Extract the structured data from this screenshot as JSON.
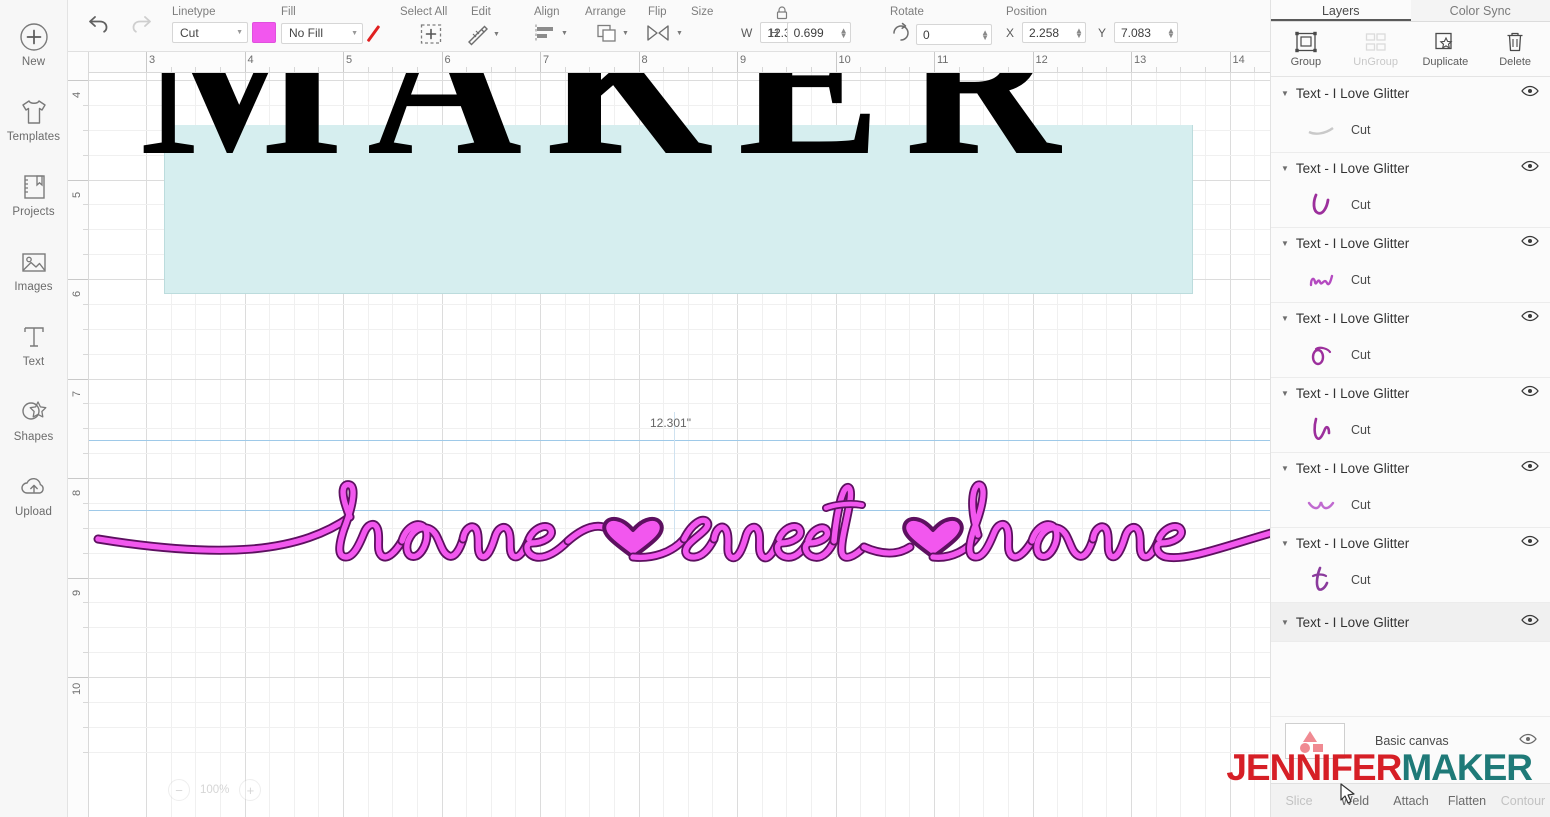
{
  "sidebar": {
    "items": [
      {
        "label": "New",
        "icon": "plus-circle-icon"
      },
      {
        "label": "Templates",
        "icon": "tshirt-icon"
      },
      {
        "label": "Projects",
        "icon": "notebook-icon"
      },
      {
        "label": "Images",
        "icon": "photo-icon"
      },
      {
        "label": "Text",
        "icon": "text-t-icon"
      },
      {
        "label": "Shapes",
        "icon": "shapes-icon"
      },
      {
        "label": "Upload",
        "icon": "upload-cloud-icon"
      }
    ]
  },
  "toolbar": {
    "undo": "undo-icon",
    "redo": "redo-icon",
    "linetype": {
      "label": "Linetype",
      "value": "Cut",
      "swatch_color": "#F257EE"
    },
    "fill": {
      "label": "Fill",
      "value": "No Fill",
      "slash_color": "#e02020"
    },
    "select_all": {
      "label": "Select All"
    },
    "edit": {
      "label": "Edit"
    },
    "align": {
      "label": "Align"
    },
    "arrange": {
      "label": "Arrange"
    },
    "flip": {
      "label": "Flip"
    },
    "size": {
      "label": "Size",
      "w_axis": "W",
      "w_value": "12.301",
      "h_axis": "H",
      "h_value": "0.699",
      "lock": "lock-icon"
    },
    "rotate": {
      "label": "Rotate",
      "value": "0"
    },
    "position": {
      "label": "Position",
      "x_axis": "X",
      "x_value": "2.258",
      "y_axis": "Y",
      "y_value": "7.083"
    }
  },
  "canvas": {
    "ruler_h": [
      "3",
      "4",
      "5",
      "6",
      "7",
      "8",
      "9",
      "10",
      "11",
      "12",
      "13",
      "14"
    ],
    "ruler_v": [
      "4",
      "5",
      "6",
      "7",
      "8",
      "9",
      "10"
    ],
    "top_text": "MAKER",
    "selection_size_label": "12.301\"",
    "script_text": "home sweet home",
    "script_color": "#F257EE",
    "script_outline_color": "#5d1060",
    "template_color": "#d6eeef",
    "zoom_value": "100%",
    "zoom_out_icon": "minus-circle-icon",
    "zoom_in_icon": "plus-circle-icon"
  },
  "right_panel": {
    "tabs": [
      {
        "label": "Layers",
        "active": true
      },
      {
        "label": "Color Sync",
        "active": false
      }
    ],
    "actions": [
      {
        "label": "Group",
        "icon": "group-icon",
        "disabled": false
      },
      {
        "label": "UnGroup",
        "icon": "ungroup-icon",
        "disabled": true
      },
      {
        "label": "Duplicate",
        "icon": "duplicate-icon",
        "disabled": false
      },
      {
        "label": "Delete",
        "icon": "trash-icon",
        "disabled": false
      }
    ],
    "layers": [
      {
        "name": "Text - I Love Glitter",
        "sublabel": "Cut",
        "thumb": "stroke-swash",
        "selected": false
      },
      {
        "name": "Text - I Love Glitter",
        "sublabel": "Cut",
        "thumb": "letter-h",
        "selected": false
      },
      {
        "name": "Text - I Love Glitter",
        "sublabel": "Cut",
        "thumb": "letter-m",
        "selected": false
      },
      {
        "name": "Text - I Love Glitter",
        "sublabel": "Cut",
        "thumb": "letter-o",
        "selected": false
      },
      {
        "name": "Text - I Love Glitter",
        "sublabel": "Cut",
        "thumb": "letter-h2",
        "selected": false
      },
      {
        "name": "Text - I Love Glitter",
        "sublabel": "Cut",
        "thumb": "letter-w",
        "selected": false
      },
      {
        "name": "Text - I Love Glitter",
        "sublabel": "Cut",
        "thumb": "letter-t",
        "selected": false
      },
      {
        "name": "Text - I Love Glitter",
        "sublabel": null,
        "thumb": null,
        "selected": true
      }
    ],
    "canvas_row": {
      "label": "Basic canvas",
      "thumb": "shapes-thumb"
    },
    "bottom_actions": [
      {
        "label": "Slice",
        "disabled": true
      },
      {
        "label": "Weld",
        "disabled": false
      },
      {
        "label": "Attach",
        "disabled": false
      },
      {
        "label": "Flatten",
        "disabled": false
      },
      {
        "label": "Contour",
        "disabled": true
      }
    ]
  },
  "watermark": {
    "part_a": "JENNIFER",
    "part_b": "MAKER",
    "color_a": "#d61f26",
    "color_b": "#1f7a78"
  }
}
